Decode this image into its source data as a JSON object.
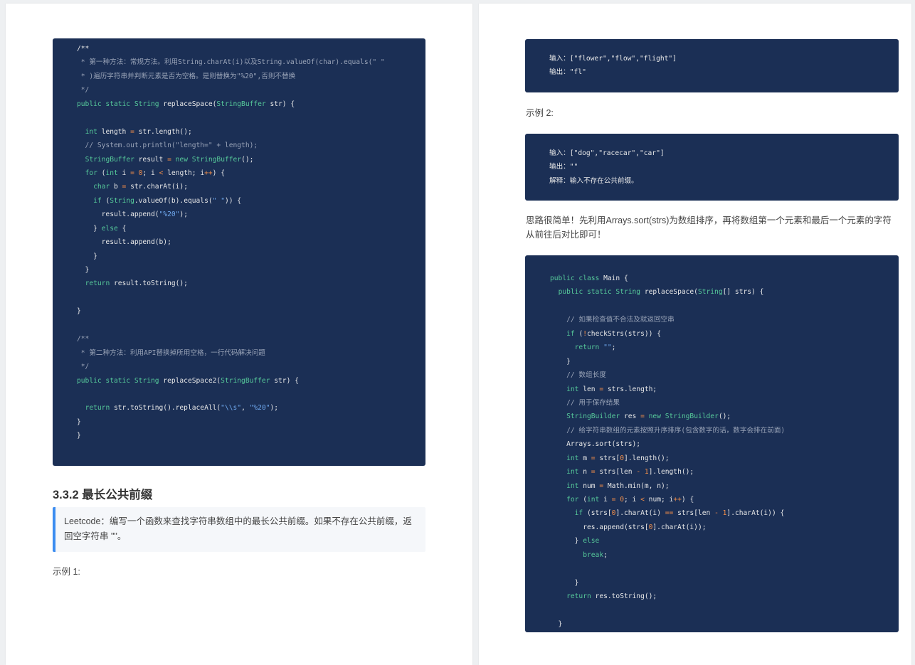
{
  "left": {
    "code_block": [
      [
        [
          "p",
          "/**"
        ]
      ],
      [
        [
          "c",
          " * 第一种方法：常规方法。利用String.charAt(i)以及String.valueOf(char).equals(\" \""
        ]
      ],
      [
        [
          "c",
          " * )遍历字符串并判断元素是否为空格。是则替换为\"%20\",否则不替换"
        ]
      ],
      [
        [
          "c",
          " */"
        ]
      ],
      [
        [
          "k",
          "public static String "
        ],
        [
          "p",
          "replaceSpace("
        ],
        [
          "k",
          "StringBuffer"
        ],
        [
          "p",
          " str) {"
        ]
      ],
      [],
      [
        [
          "p",
          "  "
        ],
        [
          "k",
          "int"
        ],
        [
          "p",
          " length "
        ],
        [
          "o",
          "="
        ],
        [
          "p",
          " str.length();"
        ]
      ],
      [
        [
          "c",
          "  // System.out.println(\"length=\" + length);"
        ]
      ],
      [
        [
          "p",
          "  "
        ],
        [
          "k",
          "StringBuffer"
        ],
        [
          "p",
          " result "
        ],
        [
          "o",
          "="
        ],
        [
          "p",
          " "
        ],
        [
          "k",
          "new StringBuffer"
        ],
        [
          "p",
          "();"
        ]
      ],
      [
        [
          "p",
          "  "
        ],
        [
          "k",
          "for"
        ],
        [
          "p",
          " ("
        ],
        [
          "k",
          "int"
        ],
        [
          "p",
          " i "
        ],
        [
          "o",
          "="
        ],
        [
          "p",
          " "
        ],
        [
          "n",
          "0"
        ],
        [
          "p",
          "; i "
        ],
        [
          "o",
          "<"
        ],
        [
          "p",
          " length; i"
        ],
        [
          "o",
          "++"
        ],
        [
          "p",
          ") {"
        ]
      ],
      [
        [
          "p",
          "    "
        ],
        [
          "k",
          "char"
        ],
        [
          "p",
          " b "
        ],
        [
          "o",
          "="
        ],
        [
          "p",
          " str.charAt(i);"
        ]
      ],
      [
        [
          "p",
          "    "
        ],
        [
          "k",
          "if"
        ],
        [
          "p",
          " ("
        ],
        [
          "k",
          "String"
        ],
        [
          "p",
          ".valueOf(b).equals("
        ],
        [
          "s",
          "\" \""
        ],
        [
          "p",
          ")) {"
        ]
      ],
      [
        [
          "p",
          "      result.append("
        ],
        [
          "s",
          "\"%20\""
        ],
        [
          "p",
          ");"
        ]
      ],
      [
        [
          "p",
          "    } "
        ],
        [
          "k",
          "else"
        ],
        [
          "p",
          " {"
        ]
      ],
      [
        [
          "p",
          "      result.append(b);"
        ]
      ],
      [
        [
          "p",
          "    }"
        ]
      ],
      [
        [
          "p",
          "  }"
        ]
      ],
      [
        [
          "p",
          "  "
        ],
        [
          "k",
          "return"
        ],
        [
          "p",
          " result.toString();"
        ]
      ],
      [],
      [
        [
          "p",
          "}"
        ]
      ],
      [],
      [
        [
          "c",
          "/**"
        ]
      ],
      [
        [
          "c",
          " * 第二种方法：利用API替换掉所用空格，一行代码解决问题"
        ]
      ],
      [
        [
          "c",
          " */"
        ]
      ],
      [
        [
          "k",
          "public static String "
        ],
        [
          "p",
          "replaceSpace2("
        ],
        [
          "k",
          "StringBuffer"
        ],
        [
          "p",
          " str) {"
        ]
      ],
      [],
      [
        [
          "p",
          "  "
        ],
        [
          "k",
          "return"
        ],
        [
          "p",
          " str.toString().replaceAll("
        ],
        [
          "s",
          "\"\\\\s\""
        ],
        [
          "p",
          ", "
        ],
        [
          "s",
          "\"%20\""
        ],
        [
          "p",
          ");"
        ]
      ],
      [
        [
          "p",
          "}"
        ]
      ],
      [
        [
          "p",
          "}"
        ]
      ]
    ],
    "heading": "3.3.2 最长公共前缀",
    "quote": "Leetcode：编写一个函数来查找字符串数组中的最长公共前缀。如果不存在公共前缀，返回空字符串 \"\"。",
    "example1_label": "示例 1:"
  },
  "right": {
    "example1_code": [
      [
        [
          "p",
          "输入：[\"flower\",\"flow\",\"flight\"]"
        ]
      ],
      [
        [
          "p",
          "输出：\"fl\""
        ]
      ]
    ],
    "example2_label": "示例 2:",
    "example2_code": [
      [
        [
          "p",
          "输入：[\"dog\",\"racecar\",\"car\"]"
        ]
      ],
      [
        [
          "p",
          "输出：\"\""
        ]
      ],
      [
        [
          "p",
          "解释：输入不存在公共前缀。"
        ]
      ]
    ],
    "paragraph": "思路很简单！先利用Arrays.sort(strs)为数组排序，再将数组第一个元素和最后一个元素的字符从前往后对比即可！",
    "solution_code": [
      [
        [
          "k",
          "public class "
        ],
        [
          "p",
          "Main {"
        ]
      ],
      [
        [
          "p",
          "  "
        ],
        [
          "k",
          "public static String "
        ],
        [
          "p",
          "replaceSpace("
        ],
        [
          "k",
          "String"
        ],
        [
          "p",
          "[] strs) {"
        ]
      ],
      [],
      [
        [
          "c",
          "    // 如果检查值不合法及就返回空串"
        ]
      ],
      [
        [
          "p",
          "    "
        ],
        [
          "k",
          "if"
        ],
        [
          "p",
          " ("
        ],
        [
          "o",
          "!"
        ],
        [
          "p",
          "checkStrs(strs)) {"
        ]
      ],
      [
        [
          "p",
          "      "
        ],
        [
          "k",
          "return"
        ],
        [
          "p",
          " "
        ],
        [
          "s",
          "\"\""
        ],
        [
          "p",
          ";"
        ]
      ],
      [
        [
          "p",
          "    }"
        ]
      ],
      [
        [
          "c",
          "    // 数组长度"
        ]
      ],
      [
        [
          "p",
          "    "
        ],
        [
          "k",
          "int"
        ],
        [
          "p",
          " len "
        ],
        [
          "o",
          "="
        ],
        [
          "p",
          " strs.length;"
        ]
      ],
      [
        [
          "c",
          "    // 用于保存结果"
        ]
      ],
      [
        [
          "p",
          "    "
        ],
        [
          "k",
          "StringBuilder"
        ],
        [
          "p",
          " res "
        ],
        [
          "o",
          "="
        ],
        [
          "p",
          " "
        ],
        [
          "k",
          "new StringBuilder"
        ],
        [
          "p",
          "();"
        ]
      ],
      [
        [
          "c",
          "    // 给字符串数组的元素按照升序排序(包含数字的话，数字会排在前面)"
        ]
      ],
      [
        [
          "p",
          "    Arrays.sort(strs);"
        ]
      ],
      [
        [
          "p",
          "    "
        ],
        [
          "k",
          "int"
        ],
        [
          "p",
          " m "
        ],
        [
          "o",
          "="
        ],
        [
          "p",
          " strs["
        ],
        [
          "n",
          "0"
        ],
        [
          "p",
          "].length();"
        ]
      ],
      [
        [
          "p",
          "    "
        ],
        [
          "k",
          "int"
        ],
        [
          "p",
          " n "
        ],
        [
          "o",
          "="
        ],
        [
          "p",
          " strs[len "
        ],
        [
          "o",
          "-"
        ],
        [
          "p",
          " "
        ],
        [
          "n",
          "1"
        ],
        [
          "p",
          "].length();"
        ]
      ],
      [
        [
          "p",
          "    "
        ],
        [
          "k",
          "int"
        ],
        [
          "p",
          " num "
        ],
        [
          "o",
          "="
        ],
        [
          "p",
          " Math.min(m, n);"
        ]
      ],
      [
        [
          "p",
          "    "
        ],
        [
          "k",
          "for"
        ],
        [
          "p",
          " ("
        ],
        [
          "k",
          "int"
        ],
        [
          "p",
          " i "
        ],
        [
          "o",
          "="
        ],
        [
          "p",
          " "
        ],
        [
          "n",
          "0"
        ],
        [
          "p",
          "; i "
        ],
        [
          "o",
          "<"
        ],
        [
          "p",
          " num; i"
        ],
        [
          "o",
          "++"
        ],
        [
          "p",
          ") {"
        ]
      ],
      [
        [
          "p",
          "      "
        ],
        [
          "k",
          "if"
        ],
        [
          "p",
          " (strs["
        ],
        [
          "n",
          "0"
        ],
        [
          "p",
          "].charAt(i) "
        ],
        [
          "o",
          "=="
        ],
        [
          "p",
          " strs[len "
        ],
        [
          "o",
          "-"
        ],
        [
          "p",
          " "
        ],
        [
          "n",
          "1"
        ],
        [
          "p",
          "].charAt(i)) {"
        ]
      ],
      [
        [
          "p",
          "        res.append(strs["
        ],
        [
          "n",
          "0"
        ],
        [
          "p",
          "].charAt(i));"
        ]
      ],
      [
        [
          "p",
          "      } "
        ],
        [
          "k",
          "else"
        ]
      ],
      [
        [
          "p",
          "        "
        ],
        [
          "k",
          "break"
        ],
        [
          "p",
          ";"
        ]
      ],
      [],
      [
        [
          "p",
          "      }"
        ]
      ],
      [
        [
          "p",
          "    "
        ],
        [
          "k",
          "return"
        ],
        [
          "p",
          " res.toString();"
        ]
      ],
      [],
      [
        [
          "p",
          "  }"
        ]
      ]
    ]
  }
}
